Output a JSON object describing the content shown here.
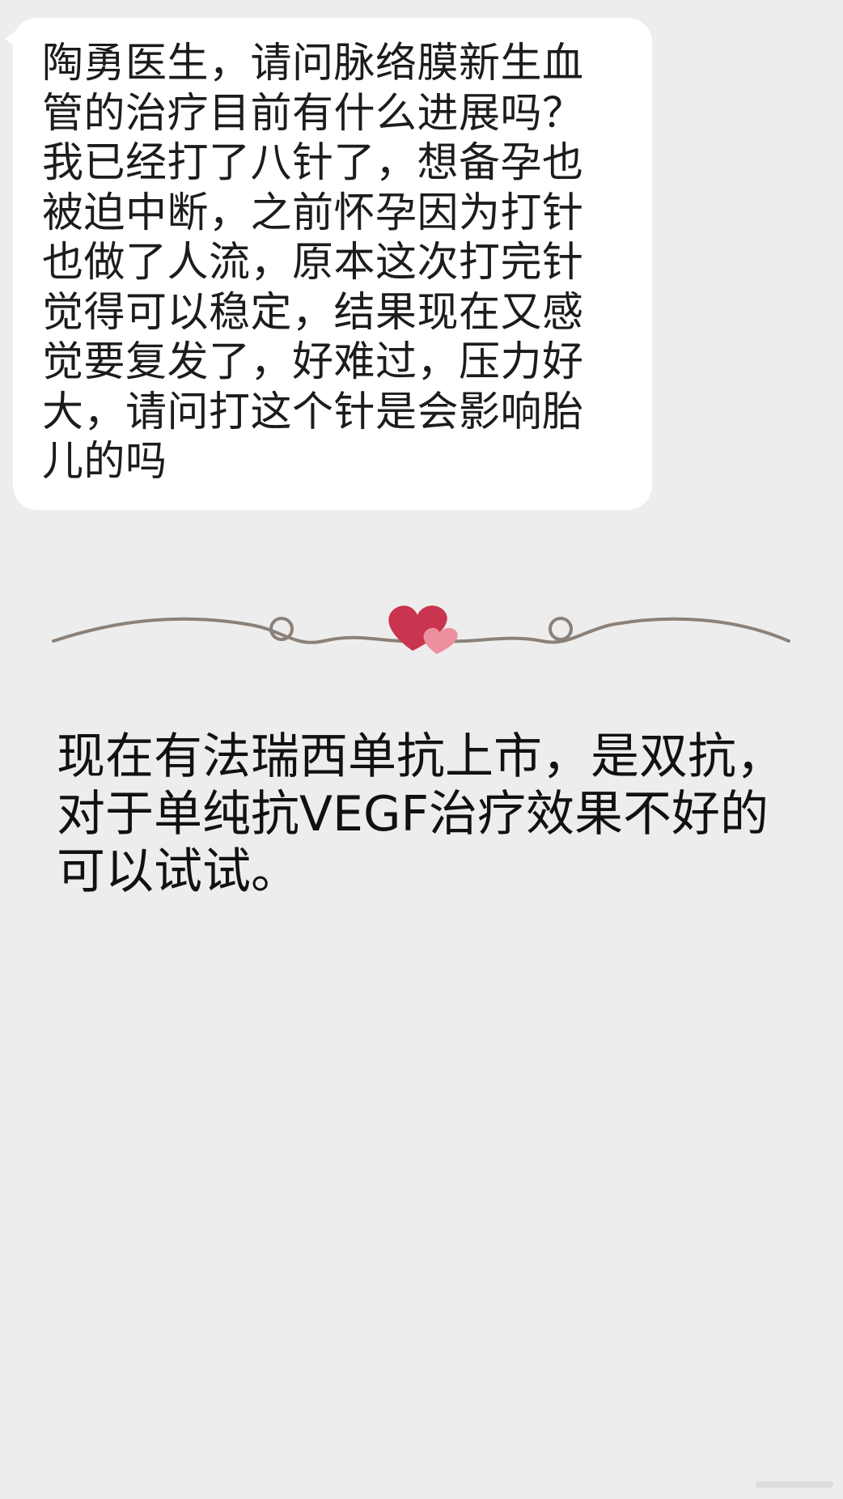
{
  "question": {
    "text": "陶勇医生，请问脉络膜新生血管的治疗目前有什么进展吗？我已经打了八针了，想备孕也被迫中断，之前怀孕因为打针也做了人流，原本这次打完针觉得可以稳定，结果现在又感觉要复发了，好难过，压力好大，请问打这个针是会影响胎儿的吗"
  },
  "divider": {
    "icon": "heart-divider-icon",
    "colors": {
      "line": "#8b8178",
      "heart_main": "#c9344f",
      "heart_small": "#ee8fa0"
    }
  },
  "answer": {
    "text": "现在有法瑞西单抗上市，是双抗，对于单纯抗VEGF治疗效果不好的可以试试。"
  },
  "colors": {
    "background": "#ededed",
    "bubble": "#ffffff",
    "text": "#1c1c1c"
  }
}
